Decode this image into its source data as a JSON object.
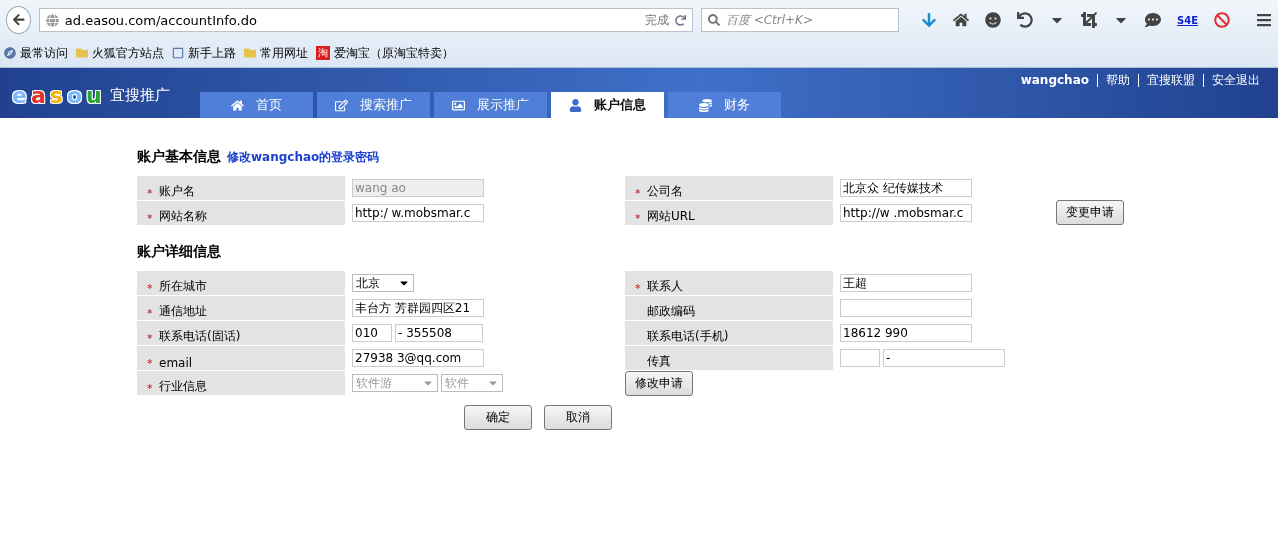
{
  "browser": {
    "url": "ad.easou.com/accountInfo.do",
    "status": "完成",
    "search_placeholder": "百度 <Ctrl+K>",
    "addon_badge": "S4E",
    "bookmarks": [
      {
        "label": "最常访问",
        "kind": "page"
      },
      {
        "label": "火狐官方站点",
        "kind": "folder"
      },
      {
        "label": "新手上路",
        "kind": "dashed"
      },
      {
        "label": "常用网址",
        "kind": "folder"
      },
      {
        "label": "爱淘宝（原淘宝特卖）",
        "kind": "brand",
        "badge": "淘"
      }
    ]
  },
  "header": {
    "logo_letters": [
      {
        "ch": "e",
        "color": "#7ab8ff"
      },
      {
        "ch": "a",
        "color": "#e0302a"
      },
      {
        "ch": "s",
        "color": "#f4b400"
      },
      {
        "ch": "o",
        "color": "#7ab8ff"
      },
      {
        "ch": "u",
        "color": "#2aa42a"
      }
    ],
    "brand": "宜搜推广",
    "user_links": [
      "wangchao",
      "帮助",
      "宜搜联盟",
      "安全退出"
    ],
    "required_mark": "*",
    "tabs": [
      {
        "label": "首页",
        "selected": false
      },
      {
        "label": "搜索推广",
        "selected": false
      },
      {
        "label": "展示推广",
        "selected": false
      },
      {
        "label": "账户信息",
        "selected": true
      },
      {
        "label": "财务",
        "selected": false
      }
    ]
  },
  "basic": {
    "title": "账户基本信息",
    "link": "修改wangchao的登录密码",
    "left": [
      {
        "label": "账户名",
        "required": true,
        "kind": "text",
        "value": "wang ao",
        "disabled": true
      },
      {
        "label": "网站名称",
        "required": true,
        "kind": "text",
        "value": "http:/ w.mobsmar.c",
        "disabled": false
      }
    ],
    "right": [
      {
        "label": "公司名",
        "required": true,
        "kind": "text",
        "value": "北京众 纪传媒技术",
        "disabled": false
      },
      {
        "label": "网站URL",
        "required": true,
        "kind": "text",
        "value": "http://w .mobsmar.c",
        "disabled": false
      }
    ],
    "button": "变更申请"
  },
  "detail": {
    "title": "账户详细信息",
    "left": [
      {
        "label": "所在城市",
        "required": true,
        "kind": "select",
        "value": "北京",
        "disabled": false
      },
      {
        "label": "通信地址",
        "required": true,
        "kind": "text",
        "value": "丰台方 芳群园四区21",
        "disabled": false
      },
      {
        "label": "联系电话(固话)",
        "required": true,
        "kind": "pair",
        "value": "010",
        "value2": "- 355508",
        "disabled": false
      },
      {
        "label": "email",
        "required": true,
        "kind": "text",
        "value": "27938 3@qq.com",
        "disabled": false
      },
      {
        "label": "行业信息",
        "required": true,
        "kind": "selects",
        "value": "软件游",
        "value2": "软件",
        "disabled": true
      }
    ],
    "right": [
      {
        "label": "联系人",
        "required": true,
        "kind": "text",
        "value": "王超",
        "disabled": false
      },
      {
        "label": "邮政编码",
        "required": false,
        "kind": "text",
        "disabled": false
      },
      {
        "label": "联系电话(手机)",
        "required": false,
        "kind": "text",
        "value": "18612 990",
        "disabled": false
      },
      {
        "label": "传真",
        "required": false,
        "kind": "pair",
        "value2": "-",
        "disabled": false
      }
    ],
    "button": "修改申请"
  },
  "actions": [
    "确定",
    "取消"
  ]
}
